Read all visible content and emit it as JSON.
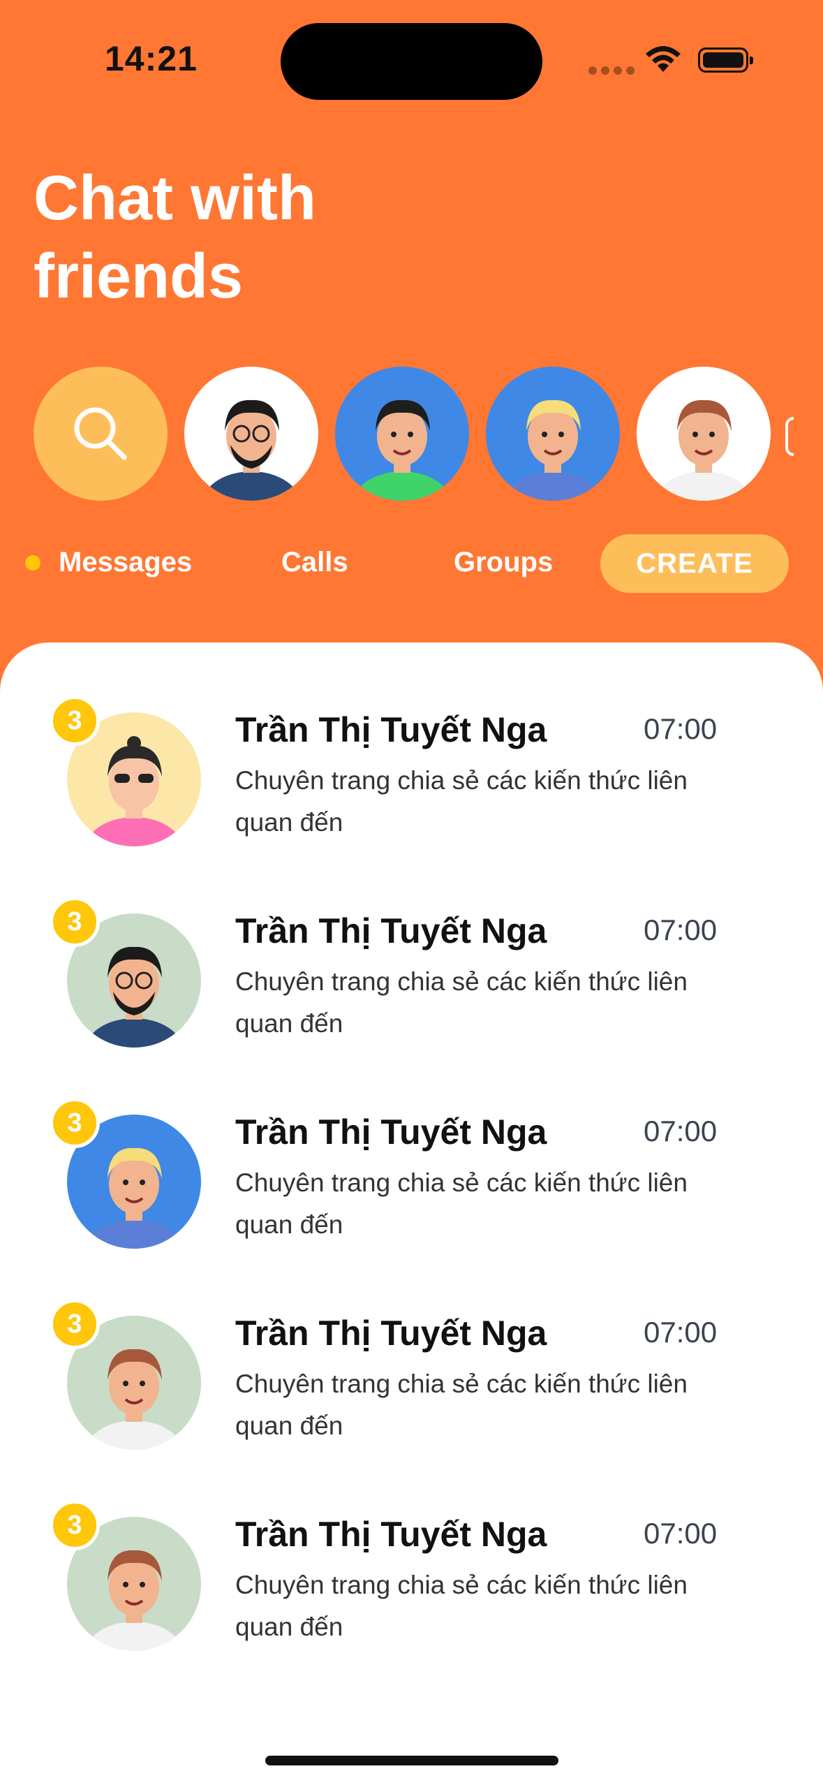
{
  "status_bar": {
    "time": "14:21"
  },
  "header": {
    "title": "Chat with\nfriends"
  },
  "stories": {
    "search_icon": "search-icon",
    "avatars": [
      {
        "bg": "#FFFFFF",
        "style": "beard"
      },
      {
        "bg": "#3F88E6",
        "style": "dark-hair"
      },
      {
        "bg": "#3F88E6",
        "style": "blond"
      },
      {
        "bg": "#FFFFFF",
        "style": "brown"
      }
    ]
  },
  "tabs": {
    "messages": "Messages",
    "calls": "Calls",
    "groups": "Groups",
    "create": "CREATE",
    "active": "messages"
  },
  "chats": [
    {
      "name": "Trần Thị Tuyết Nga",
      "time": "07:00",
      "message": "Chuyên trang chia sẻ các kiến thức liên quan đến",
      "unread": "3",
      "avatar_bg": "#FDE7A8",
      "avatar_style": "sunglasses"
    },
    {
      "name": "Trần Thị Tuyết Nga",
      "time": "07:00",
      "message": "Chuyên trang chia sẻ các kiến thức liên quan đến",
      "unread": "3",
      "avatar_bg": "#C8DCC8",
      "avatar_style": "beard"
    },
    {
      "name": "Trần Thị Tuyết Nga",
      "time": "07:00",
      "message": "Chuyên trang chia sẻ các kiến thức liên quan đến",
      "unread": "3",
      "avatar_bg": "#3F88E6",
      "avatar_style": "blond"
    },
    {
      "name": "Trần Thị Tuyết Nga",
      "time": "07:00",
      "message": "Chuyên trang chia sẻ các kiến thức liên quan đến",
      "unread": "3",
      "avatar_bg": "#C8DCC8",
      "avatar_style": "brown"
    },
    {
      "name": "Trần Thị Tuyết Nga",
      "time": "07:00",
      "message": "Chuyên trang chia sẻ các kiến thức liên quan đến",
      "unread": "3",
      "avatar_bg": "#C8DCC8",
      "avatar_style": "brown"
    }
  ],
  "colors": {
    "brand": "#FF7733",
    "accent": "#FDBE5A",
    "badge": "#FFC60A"
  }
}
